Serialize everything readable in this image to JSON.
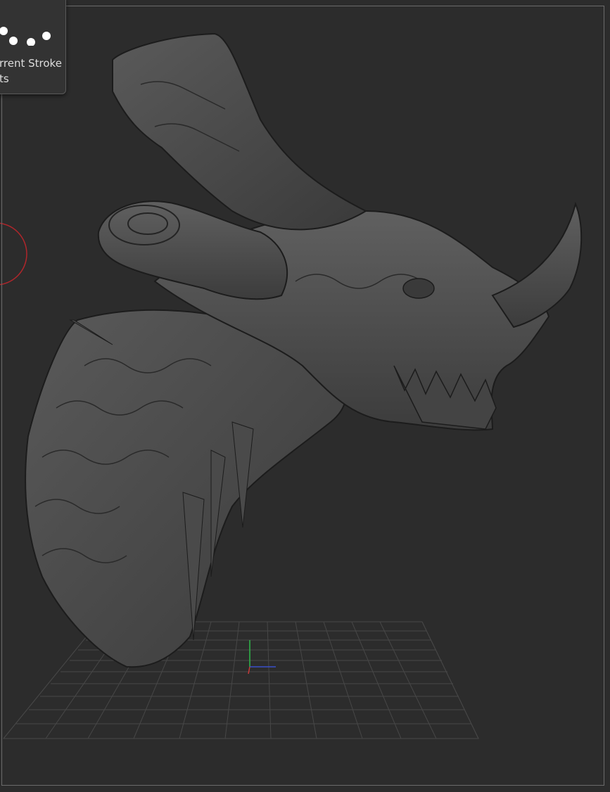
{
  "popup": {
    "line1": "rrent Stroke",
    "line2": "ts"
  },
  "viewport": {
    "background": "#2c2c2c",
    "grid_color": "#4a4a4a",
    "axis_x_color": "#3a4fc9",
    "axis_y_color": "#2fb84a",
    "axis_z_color": "#c93a3a",
    "cursor_ring_color": "#b0262b",
    "model_icon": "dragon-head-sculpt"
  }
}
